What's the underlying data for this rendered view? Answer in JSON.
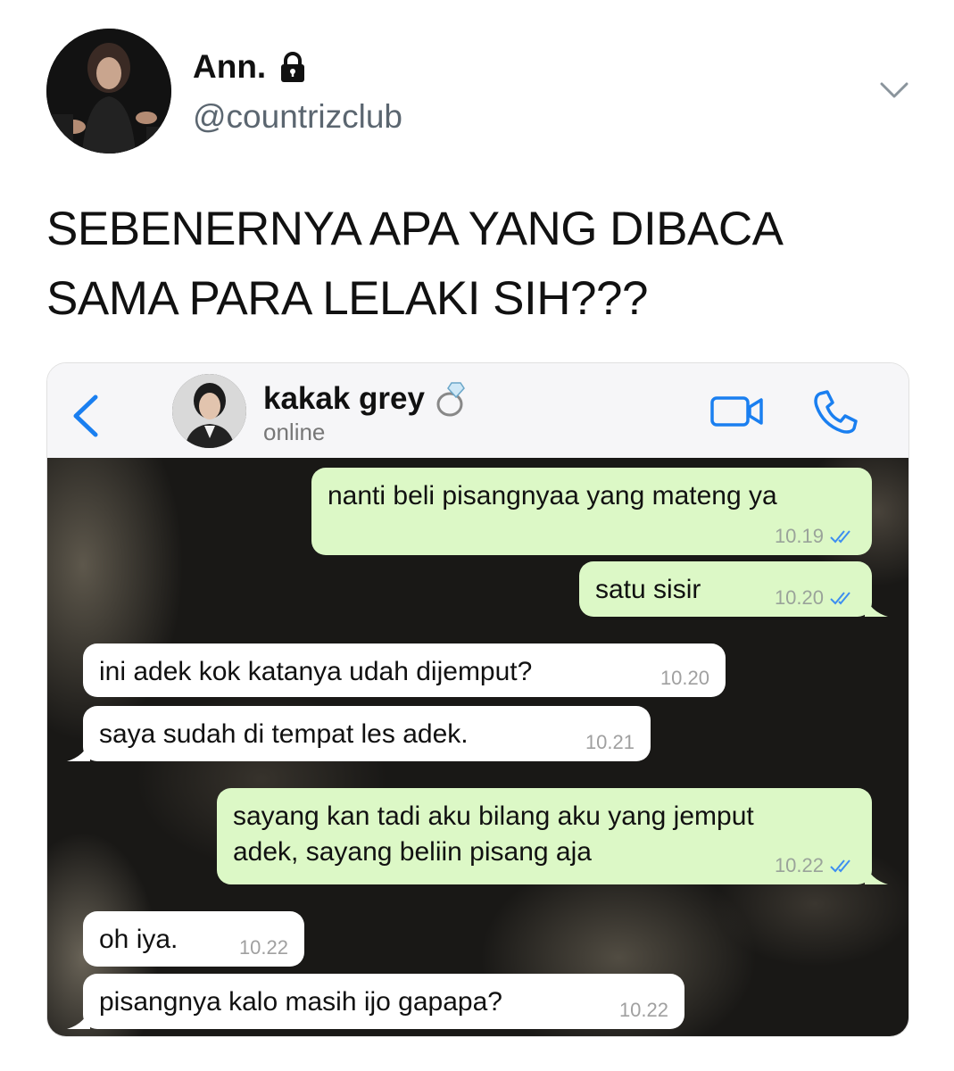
{
  "tweet": {
    "user_name": "Ann.",
    "handle": "@countrizclub",
    "text_lines": [
      "SEBENERNYA APA YANG DIBACA",
      "SAMA PARA LELAKI SIH???"
    ],
    "icons": {
      "lock": "lock-icon",
      "menu": "chevron-down-icon"
    }
  },
  "chat": {
    "contact_name": "kakak grey",
    "contact_emoji": "ring-icon",
    "status": "online",
    "colors": {
      "accent": "#1a7ff0",
      "sent_bubble": "#dcf8c6",
      "received_bubble": "#ffffff",
      "read_ticks": "#3d8ef0"
    },
    "messages": [
      {
        "direction": "sent",
        "lines": [
          "nanti beli pisangnyaa yang mateng ya"
        ],
        "time": "10.19",
        "read": true
      },
      {
        "direction": "sent",
        "lines": [
          "satu sisir"
        ],
        "time": "10.20",
        "read": true
      },
      {
        "direction": "received",
        "lines": [
          "ini adek kok katanya udah dijemput?"
        ],
        "time": "10.20"
      },
      {
        "direction": "received",
        "lines": [
          "saya sudah di tempat les adek."
        ],
        "time": "10.21"
      },
      {
        "direction": "sent",
        "lines": [
          "sayang kan tadi aku bilang aku yang jemput",
          "adek, sayang beliin pisang aja"
        ],
        "time": "10.22",
        "read": true
      },
      {
        "direction": "received",
        "lines": [
          "oh iya."
        ],
        "time": "10.22"
      },
      {
        "direction": "received",
        "lines": [
          "pisangnya kalo masih ijo gapapa?"
        ],
        "time": "10.22"
      }
    ]
  }
}
